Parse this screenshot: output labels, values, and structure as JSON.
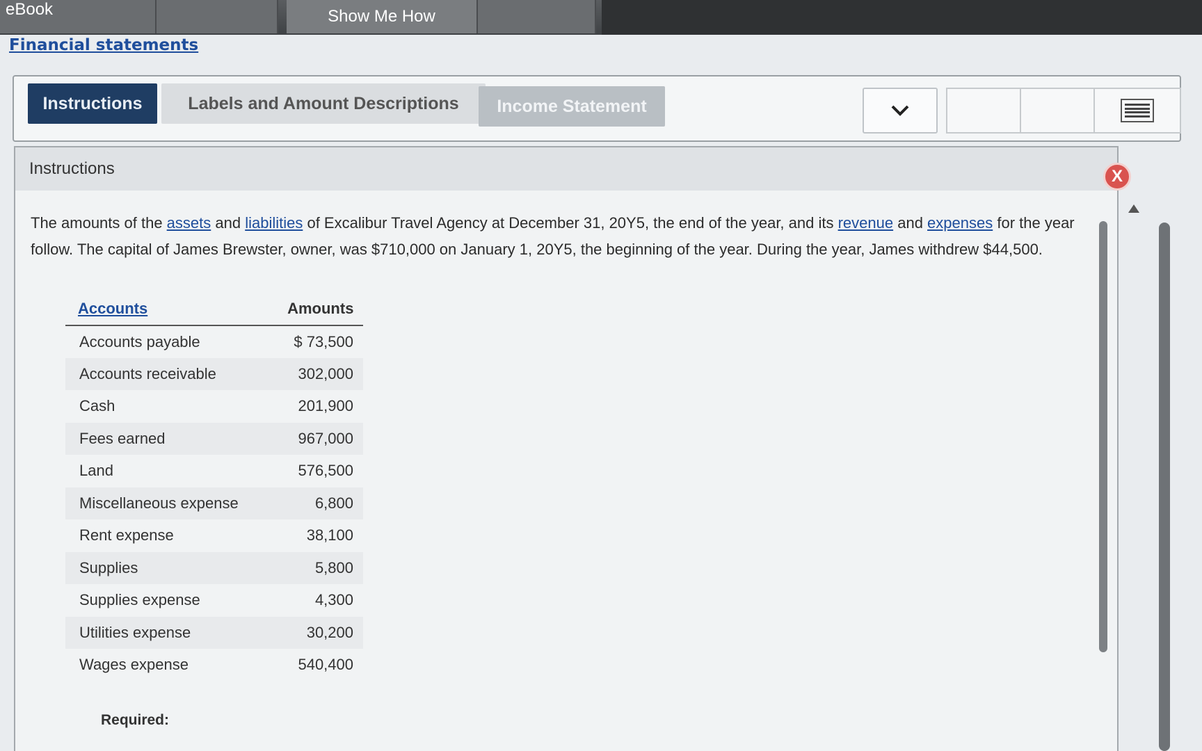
{
  "topbar": {
    "ebook_label": "eBook",
    "showme_label": "Show Me How"
  },
  "header": {
    "title_link": "Financial statements"
  },
  "tabs": {
    "instructions": "Instructions",
    "labels": "Labels and Amount Descriptions",
    "income": "Income Statement",
    "dropdown_icon": "chevron-down-icon"
  },
  "panel": {
    "title": "Instructions",
    "close_label": "X"
  },
  "intro": {
    "p1": "The amounts of the ",
    "link_assets": "assets",
    "p2": " and ",
    "link_liabilities": "liabilities",
    "p3": " of Excalibur Travel Agency at December 31, 20Y5, the end of the year, and its ",
    "link_revenue": "revenue",
    "p4": " and ",
    "link_expenses": "expenses",
    "p5": " for the year follow. The capital of James Brewster, owner, was $710,000 on January 1, 20Y5, the beginning of the year. During the year, James withdrew $44,500."
  },
  "table": {
    "headers": {
      "accounts": "Accounts",
      "amounts": "Amounts"
    },
    "rows": [
      {
        "name": "Accounts payable",
        "amount": "$ 73,500"
      },
      {
        "name": "Accounts receivable",
        "amount": "302,000"
      },
      {
        "name": "Cash",
        "amount": "201,900"
      },
      {
        "name": "Fees earned",
        "amount": "967,000"
      },
      {
        "name": "Land",
        "amount": "576,500"
      },
      {
        "name": "Miscellaneous expense",
        "amount": "6,800"
      },
      {
        "name": "Rent expense",
        "amount": "38,100"
      },
      {
        "name": "Supplies",
        "amount": "5,800"
      },
      {
        "name": "Supplies expense",
        "amount": "4,300"
      },
      {
        "name": "Utilities expense",
        "amount": "30,200"
      },
      {
        "name": "Wages expense",
        "amount": "540,400"
      }
    ]
  },
  "required_label": "Required:"
}
